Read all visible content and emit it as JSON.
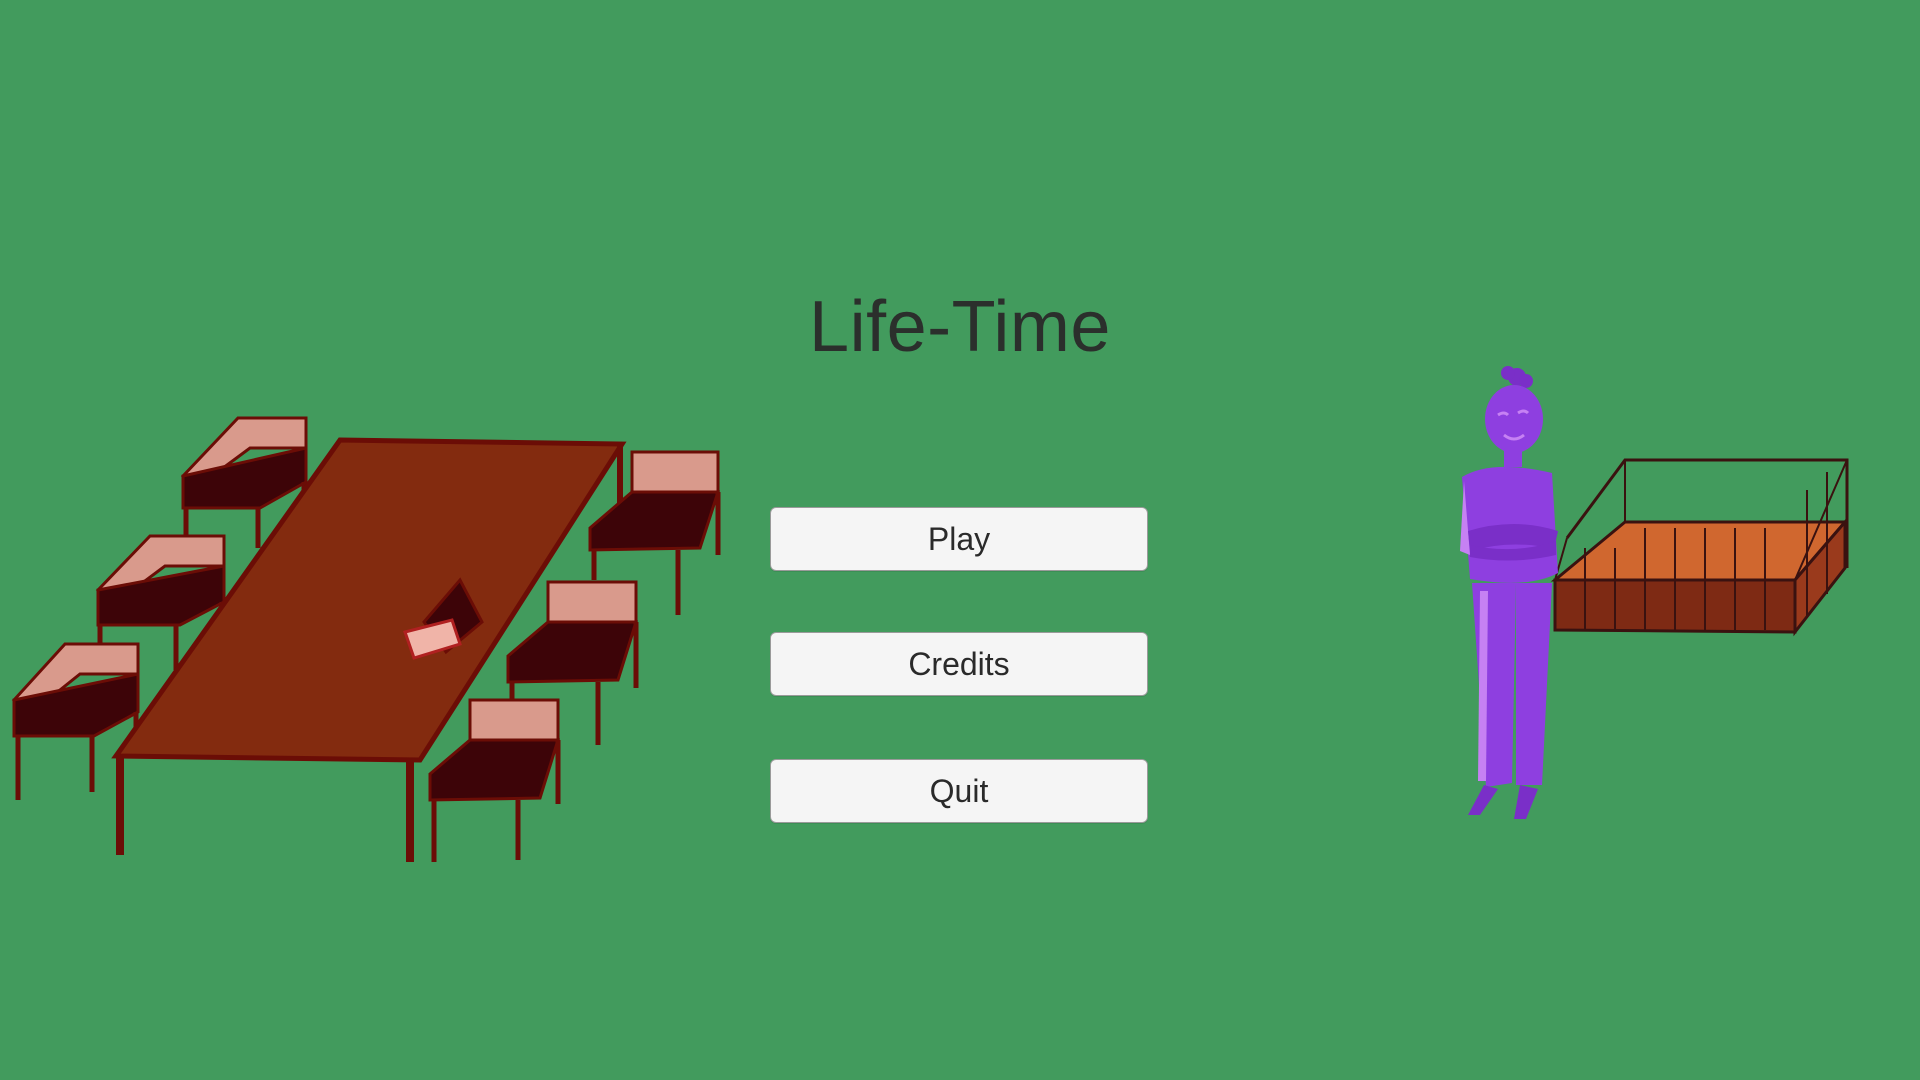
{
  "game": {
    "title": "Life-Time"
  },
  "menu": {
    "play_label": "Play",
    "credits_label": "Credits",
    "quit_label": "Quit"
  },
  "colors": {
    "background": "#429b5d",
    "button_fill": "#f5f5f5",
    "button_border": "#9a9a9a",
    "title_text": "#2b2f2c",
    "table": "#832b0f",
    "table_outline": "#6b0d06",
    "bench_top": "#d99a8c",
    "bench_dark": "#3d0408",
    "character": "#8e3fe0",
    "character_highlight": "#c681f3",
    "bed_fill": "#d0672f",
    "bed_outline": "#3a1210"
  },
  "icons": {
    "table": "meeting-table-illustration",
    "character": "standing-person-illustration",
    "bed": "bed-frame-illustration"
  }
}
